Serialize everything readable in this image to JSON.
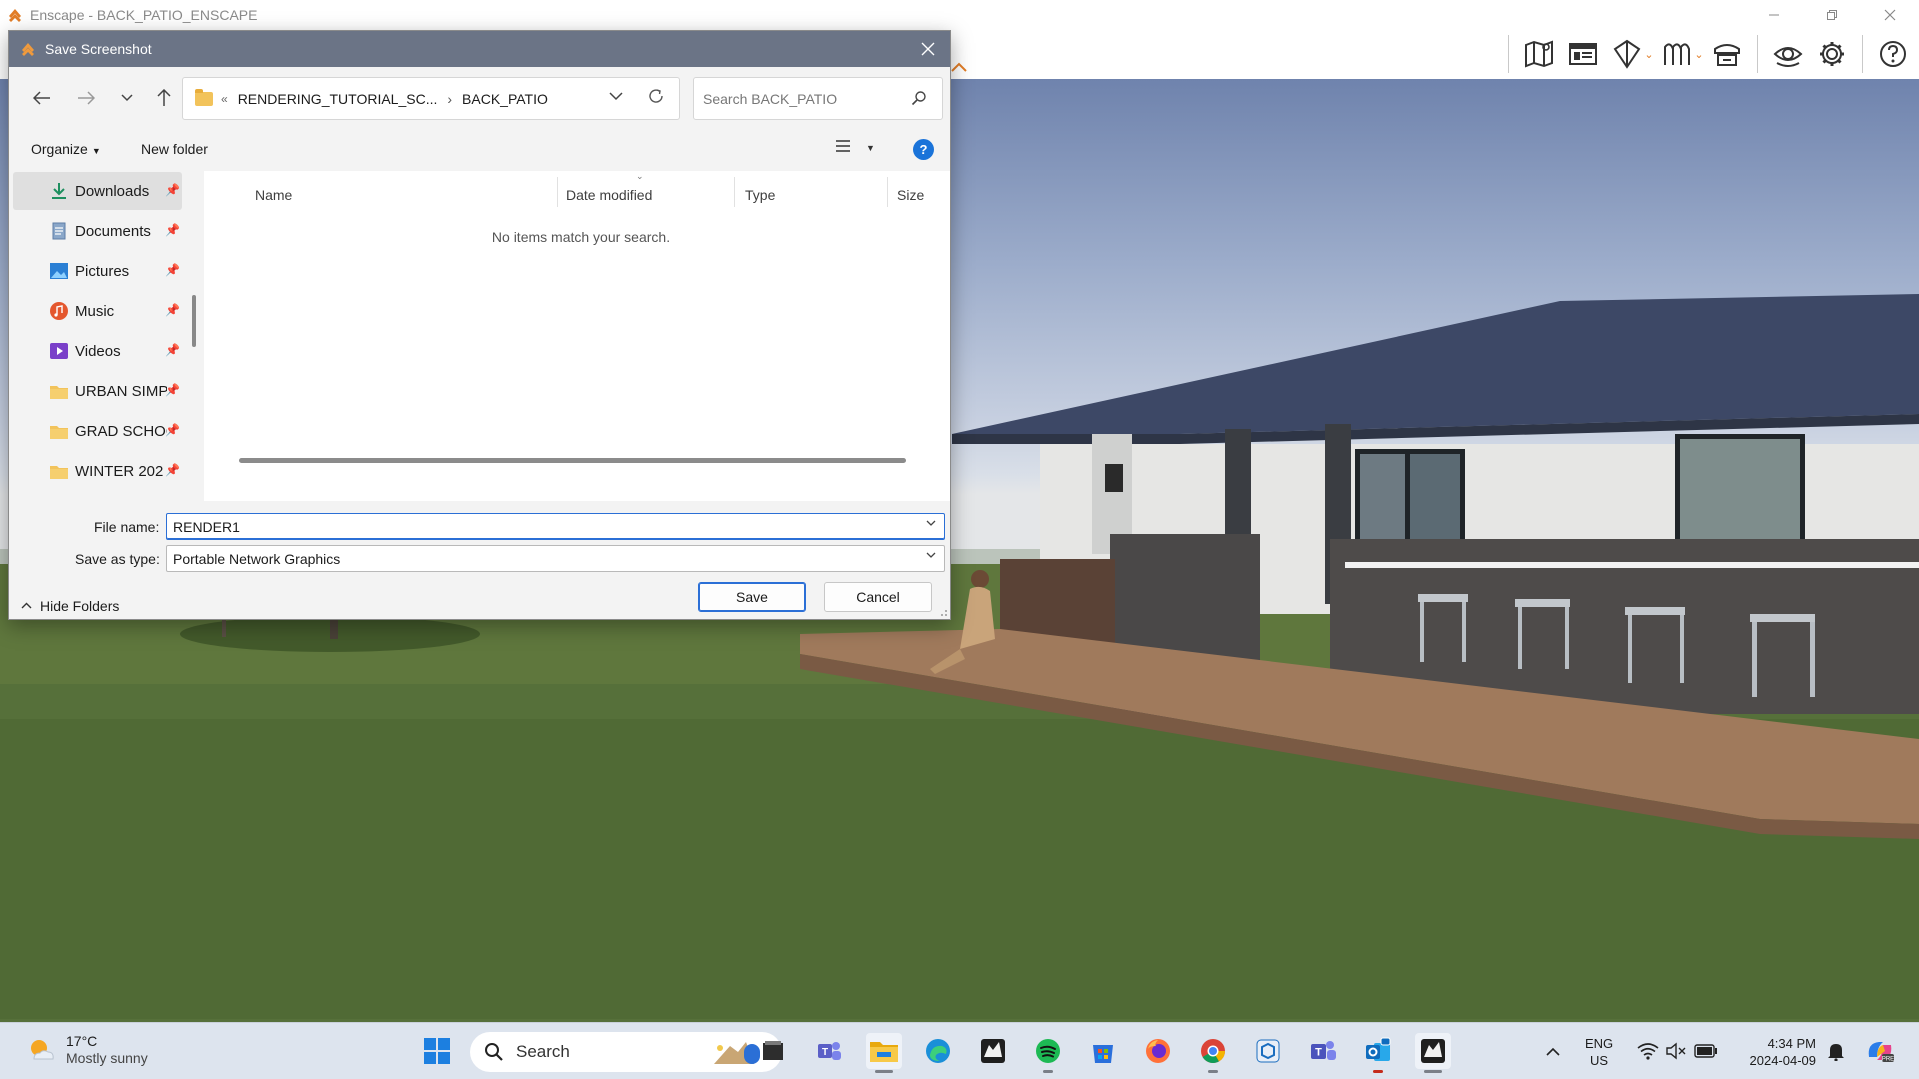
{
  "app": {
    "title": "Enscape - BACK_PATIO_ENSCAPE",
    "window_controls": [
      "minimize",
      "restore",
      "close"
    ],
    "accent_color": "#e27d26"
  },
  "enscape_toolbar": {
    "tools": [
      {
        "icon": "map-icon"
      },
      {
        "icon": "batch-render-icon"
      },
      {
        "icon": "view-management-icon",
        "has_dropdown": true
      },
      {
        "icon": "asset-library-icon",
        "has_dropdown": true
      },
      {
        "icon": "upload-icon"
      },
      {
        "icon": "visual-settings-icon"
      },
      {
        "icon": "settings-icon"
      },
      {
        "icon": "help-icon"
      }
    ]
  },
  "dialog": {
    "title": "Save Screenshot",
    "breadcrumb": [
      "RENDERING_TUTORIAL_SC...",
      "BACK_PATIO"
    ],
    "search_placeholder": "Search BACK_PATIO",
    "commands": {
      "organize": "Organize",
      "new_folder": "New folder"
    },
    "nav_items": [
      {
        "label": "Downloads",
        "icon": "download-icon",
        "selected": true
      },
      {
        "label": "Documents",
        "icon": "document-icon"
      },
      {
        "label": "Pictures",
        "icon": "pictures-icon"
      },
      {
        "label": "Music",
        "icon": "music-icon"
      },
      {
        "label": "Videos",
        "icon": "videos-icon"
      },
      {
        "label": "URBAN SIMPL",
        "icon": "folder-icon"
      },
      {
        "label": "GRAD SCHOOL",
        "icon": "folder-icon"
      },
      {
        "label": "WINTER 202",
        "icon": "folder-icon"
      }
    ],
    "columns": [
      "Name",
      "Date modified",
      "Type",
      "Size"
    ],
    "empty_message": "No items match your search.",
    "file_name_label": "File name:",
    "file_name_value": "RENDER1",
    "save_type_label": "Save as type:",
    "save_type_value": "Portable Network Graphics",
    "hide_folders": "Hide Folders",
    "save_button": "Save",
    "cancel_button": "Cancel"
  },
  "taskbar": {
    "weather": {
      "temp": "17°C",
      "condition": "Mostly sunny"
    },
    "search_label": "Search",
    "apps": [
      "start",
      "file-manager",
      "teams-personal",
      "file-explorer",
      "edge",
      "rhino",
      "spotify",
      "microsoft-store",
      "firefox",
      "chrome",
      "sketchup",
      "teams",
      "outlook",
      "rhino-active"
    ],
    "language": {
      "line1": "ENG",
      "line2": "US"
    },
    "clock": {
      "time": "4:34 PM",
      "date": "2024-04-09"
    }
  }
}
